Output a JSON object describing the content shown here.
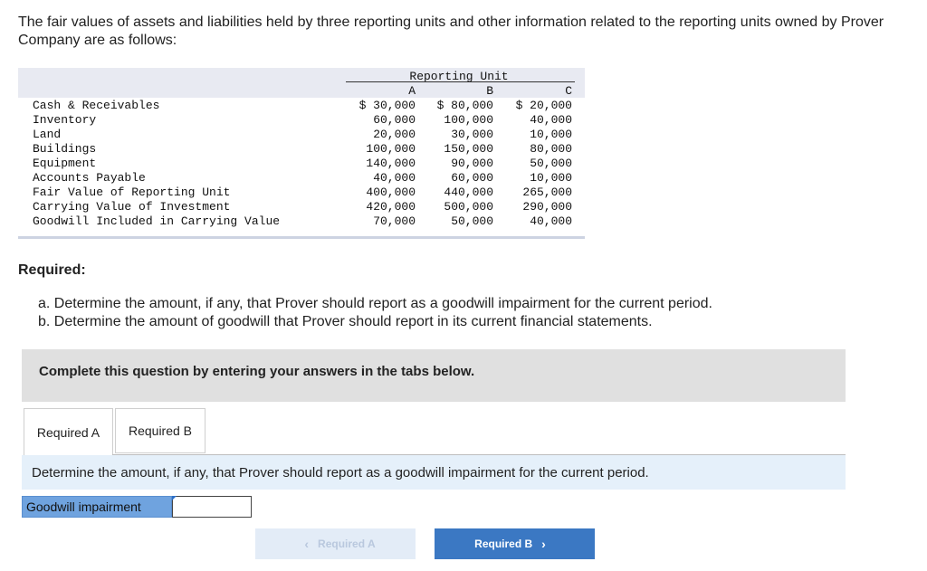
{
  "intro": "The fair values of assets and liabilities held by three reporting units and other information related to the reporting units owned by Prover Company are as follows:",
  "table": {
    "group_header": "Reporting Unit",
    "columns": [
      "A",
      "B",
      "C"
    ],
    "rows": [
      {
        "label": "Cash & Receivables",
        "a": "$ 30,000",
        "b": "$ 80,000",
        "c": "$ 20,000"
      },
      {
        "label": "Inventory",
        "a": "60,000",
        "b": "100,000",
        "c": "40,000"
      },
      {
        "label": "Land",
        "a": "20,000",
        "b": "30,000",
        "c": "10,000"
      },
      {
        "label": "Buildings",
        "a": "100,000",
        "b": "150,000",
        "c": "80,000"
      },
      {
        "label": "Equipment",
        "a": "140,000",
        "b": "90,000",
        "c": "50,000"
      },
      {
        "label": "Accounts Payable",
        "a": "40,000",
        "b": "60,000",
        "c": "10,000"
      },
      {
        "label": "Fair Value of Reporting Unit",
        "a": "400,000",
        "b": "440,000",
        "c": "265,000"
      },
      {
        "label": "Carrying Value of Investment",
        "a": "420,000",
        "b": "500,000",
        "c": "290,000"
      },
      {
        "label": "Goodwill Included in Carrying Value",
        "a": "70,000",
        "b": "50,000",
        "c": "40,000"
      }
    ]
  },
  "required": {
    "heading": "Required:",
    "items": [
      "a. Determine the amount, if any, that Prover should report as a goodwill impairment for the current period.",
      "b. Determine the amount of goodwill that Prover should report in its current financial statements."
    ]
  },
  "instruction": "Complete this question by entering your answers in the tabs below.",
  "tabs": [
    {
      "label": "Required A",
      "active": true
    },
    {
      "label": "Required B",
      "active": false
    }
  ],
  "prompt": "Determine the amount, if any, that Prover should report as a goodwill impairment for the current period.",
  "field": {
    "label": "Goodwill impairment",
    "value": ""
  },
  "nav": {
    "prev_label": "Required A",
    "next_label": "Required B",
    "prev_icon": "chevron-left-icon",
    "next_icon": "chevron-right-icon"
  },
  "colors": {
    "accent": "#3b78c3",
    "field_label_bg": "#6fa3df",
    "prompt_bg": "#e5f0fa",
    "instruction_bg": "#e0e0e0"
  }
}
